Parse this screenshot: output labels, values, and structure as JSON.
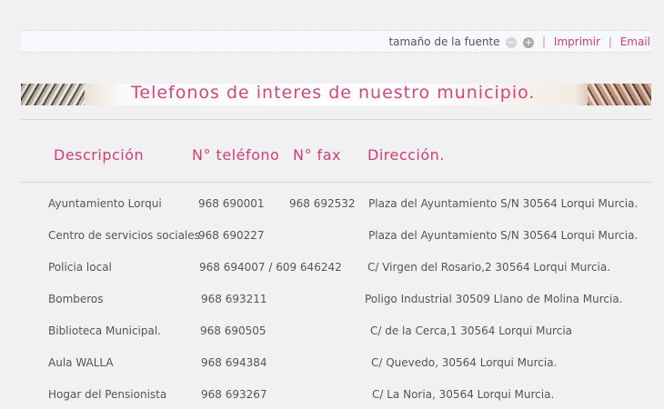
{
  "toolbar": {
    "font_size_label": "tamaño de la fuente",
    "decrease_symbol": "−",
    "increase_symbol": "+",
    "print_label": "Imprimir",
    "email_label": "Email",
    "separator": "|"
  },
  "banner": {
    "title": "Telefonos de interes de nuestro municipio."
  },
  "table": {
    "headers": {
      "description": "Descripción",
      "phone": "N° teléfono",
      "fax": "N° fax",
      "address": "Dirección."
    },
    "rows": [
      {
        "description": "Ayuntamiento Lorqui",
        "phone": "968 690001",
        "fax": "968 692532",
        "address": "Plaza del Ayuntamiento S/N 30564 Lorqui Murcia."
      },
      {
        "description": "Centro de servicios sociales",
        "phone": "968 690227",
        "fax": "",
        "address": "Plaza del Ayuntamiento S/N 30564 Lorqui Murcia."
      },
      {
        "description": "Policia local",
        "phone": "968 694007 / 609 646242",
        "fax": "",
        "address": "C/ Virgen del Rosario,2 30564 Lorqui Murcia."
      },
      {
        "description": "Bomberos",
        "phone": "968 693211",
        "fax": "",
        "address": "Poligo Industrial 30509 Llano de Molina Murcia."
      },
      {
        "description": "Biblioteca Municipal.",
        "phone": "968 690505",
        "fax": "",
        "address": "C/ de la Cerca,1 30564 Lorqui Murcia"
      },
      {
        "description": "Aula WALLA",
        "phone": "968 694384",
        "fax": "",
        "address": "C/ Quevedo, 30564 Lorqui Murcia."
      },
      {
        "description": "Hogar del Pensionista",
        "phone": "968 693267",
        "fax": "",
        "address": "C/ La Noria, 30564 Lorqui Murcia."
      }
    ]
  }
}
